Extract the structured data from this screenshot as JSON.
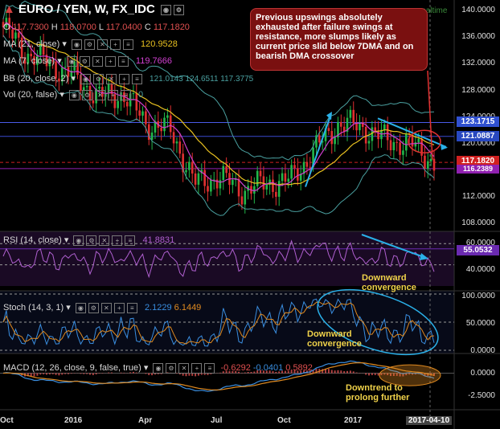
{
  "header": {
    "symbol": "EURO / YEN, W, FX_IDC",
    "ohlc": {
      "o_label": "O",
      "o": "117.7300",
      "h_label": "H",
      "h": "118.0700",
      "l_label": "L",
      "l": "117.0400",
      "c_label": "C",
      "c": "117.1820"
    },
    "realtime": "realtime"
  },
  "indicators": {
    "ma21": {
      "label": "MA (21, close)",
      "value": "120.9528",
      "color": "#e8c020"
    },
    "ma7": {
      "label": "MA (7, close)",
      "value": "119.7666",
      "color": "#d040d0"
    },
    "bb": {
      "label": "BB (20, close, 2)",
      "values": "121.0143 124.6511 117.3775",
      "color": "#4aa0a0"
    },
    "vol": {
      "label": "Vol (20, false)",
      "value": "0"
    }
  },
  "callout": "Previous upswings absolutely exhausted after failure swings at resistance, more slumps likely as current price slid below 7DMA and on bearish DMA crossover",
  "annotations": {
    "rsi_note": "Downward\nconvergence",
    "stoch_note": "Downward\nconvergence",
    "macd_note": "Downtrend to\nprolong further"
  },
  "panes": {
    "rsi": {
      "label": "RSI (14, close)",
      "value": "41.8831",
      "current_tag": "55.0532",
      "axis": [
        "60.0000",
        "40.0000"
      ]
    },
    "stoch": {
      "label": "Stoch (14, 3, 1)",
      "k": "2.1229",
      "d": "6.1449",
      "axis": [
        "100.0000",
        "50.0000",
        "0.0000"
      ]
    },
    "macd": {
      "label": "MACD (12, 26, close, 9, false, true)",
      "v1": "-0.6292",
      "v2": "-0.0401",
      "v3": "0.5892",
      "axis": [
        "0.0000",
        "-2.5000"
      ]
    }
  },
  "price_tags": {
    "t1": {
      "value": "123.1715",
      "bg": "#3050d0",
      "fg": "#ffffff"
    },
    "t2": {
      "value": "121.0887",
      "bg": "#2848c0",
      "fg": "#ffffff"
    },
    "t3": {
      "value": "117.1820",
      "bg": "#d02020",
      "fg": "#ffffff"
    },
    "t4": {
      "value": "116.2389",
      "bg": "#9020b0",
      "fg": "#ffffff"
    }
  },
  "price_axis": [
    "140.0000",
    "136.0000",
    "132.0000",
    "128.0000",
    "124.0000",
    "120.0000",
    "116.0000",
    "112.0000",
    "108.0000"
  ],
  "x_axis": [
    "Oct",
    "2016",
    "Apr",
    "Jul",
    "Oct",
    "2017",
    "2017-04-10"
  ],
  "chart_data": {
    "type": "candlestick",
    "title": "EURO / YEN, W, FX_IDC",
    "ylim": [
      106.8,
      141.6
    ],
    "x": [
      "2015-10",
      "2016-01",
      "2016-04",
      "2016-07",
      "2016-10",
      "2017-01",
      "2017-04-10"
    ],
    "close_path": [
      {
        "x": "2015-10",
        "y": 137.5
      },
      {
        "x": "2015-11",
        "y": 133.5
      },
      {
        "x": "2015-12",
        "y": 132.0
      },
      {
        "x": "2016-01",
        "y": 130.0
      },
      {
        "x": "2016-02",
        "y": 127.0
      },
      {
        "x": "2016-03",
        "y": 127.5
      },
      {
        "x": "2016-04",
        "y": 123.0
      },
      {
        "x": "2016-05",
        "y": 122.0
      },
      {
        "x": "2016-06",
        "y": 114.0
      },
      {
        "x": "2016-07",
        "y": 115.0
      },
      {
        "x": "2016-08",
        "y": 113.0
      },
      {
        "x": "2016-09",
        "y": 114.0
      },
      {
        "x": "2016-10",
        "y": 114.5
      },
      {
        "x": "2016-11",
        "y": 119.0
      },
      {
        "x": "2016-12",
        "y": 123.0
      },
      {
        "x": "2017-01",
        "y": 122.5
      },
      {
        "x": "2017-02",
        "y": 120.5
      },
      {
        "x": "2017-03",
        "y": 120.0
      },
      {
        "x": "2017-04-10",
        "y": 117.18
      }
    ],
    "series": [
      {
        "name": "MA (21, close)",
        "last": 120.9528
      },
      {
        "name": "MA (7, close)",
        "last": 119.7666
      },
      {
        "name": "BB (20, close, 2)",
        "last": [
          121.0143,
          124.6511,
          117.3775
        ]
      }
    ],
    "horizontal_levels": [
      123.1715,
      121.0887,
      117.182,
      116.2389
    ],
    "rsi": {
      "last": 41.8831,
      "ylim": [
        20,
        70
      ]
    },
    "stoch": {
      "k": 2.1229,
      "d": 6.1449,
      "ylim": [
        0,
        100
      ]
    },
    "macd": {
      "values": [
        -0.6292,
        -0.0401,
        0.5892
      ],
      "ylim": [
        -3.5,
        1.5
      ]
    }
  }
}
